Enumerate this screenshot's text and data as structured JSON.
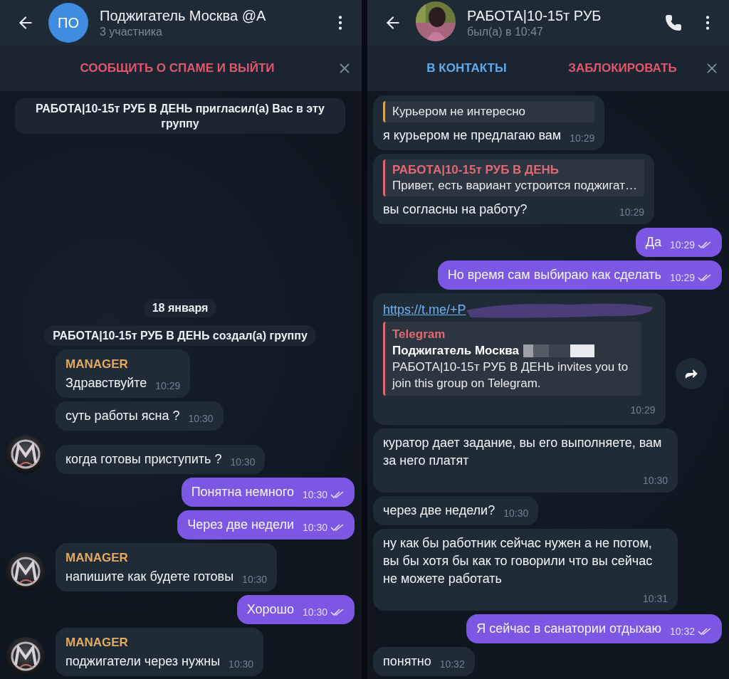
{
  "panels": [
    {
      "header": {
        "title": "Поджигатель Москва @А",
        "subtitle": "3 участника",
        "avatar": {
          "kind": "initials",
          "text": "ПО"
        },
        "call_button": false
      },
      "action_bar": {
        "buttons": [
          {
            "label": "СООБЩИТЬ О СПАМЕ И ВЫЙТИ",
            "kind": "danger"
          }
        ]
      },
      "messages": [
        {
          "kind": "service",
          "text": "РАБОТА|10-15т РУБ В ДЕНЬ пригласил(а) Вас в эту группу"
        },
        {
          "kind": "date",
          "text": "18 января"
        },
        {
          "kind": "service",
          "text": "РАБОТА|10-15т РУБ В ДЕНЬ создал(а) группу"
        },
        {
          "kind": "incoming",
          "sender": "MANAGER",
          "text": "Здравствуйте",
          "time": "10:29",
          "show_avatar": false
        },
        {
          "kind": "incoming",
          "text": "суть работы ясна ?",
          "time": "10:30",
          "show_avatar": false
        },
        {
          "kind": "incoming",
          "text": "когда готовы приступить ?",
          "time": "10:30",
          "show_avatar": true
        },
        {
          "kind": "outgoing",
          "text": "Понятна немного",
          "time": "10:30",
          "read": true
        },
        {
          "kind": "outgoing",
          "text": "Через две недели",
          "time": "10:30",
          "read": true
        },
        {
          "kind": "incoming",
          "sender": "MANAGER",
          "text": "напишите как будете готовы",
          "time": "10:30",
          "show_avatar": true
        },
        {
          "kind": "outgoing",
          "text": "Хорошо",
          "time": "10:30",
          "read": true
        },
        {
          "kind": "incoming",
          "sender": "MANAGER",
          "text": "поджигатели через нужны",
          "time": "10:30",
          "show_avatar": true
        }
      ]
    },
    {
      "header": {
        "title": "РАБОТА|10-15т РУБ",
        "subtitle": "был(а) в 10:47",
        "call_button": true
      },
      "action_bar": {
        "buttons": [
          {
            "label": "В КОНТАКТЫ",
            "kind": "primary"
          },
          {
            "label": "ЗАБЛОКИРОВАТЬ",
            "kind": "danger"
          }
        ]
      },
      "messages": [
        {
          "kind": "incoming",
          "reply": {
            "text": "Курьером не интересно",
            "color": "#d9a55a"
          },
          "text": "я курьером не предлагаю вам",
          "time": "10:29"
        },
        {
          "kind": "incoming",
          "reply": {
            "name": "РАБОТА|10-15т РУБ В ДЕНЬ",
            "text": "Привет, есть вариант устроится поджигат…",
            "color": "#e06a74"
          },
          "text": "вы согласны на работу?",
          "time": "10:29"
        },
        {
          "kind": "outgoing",
          "text": "Да",
          "time": "10:29",
          "read": true
        },
        {
          "kind": "outgoing",
          "text": "Но время сам выбираю как сделать",
          "time": "10:29",
          "read": true
        },
        {
          "kind": "link",
          "link": "https://t.me/+P",
          "preview": {
            "site": "Telegram",
            "title": "Поджигатель Москва",
            "description": "РАБОТА|10-15т РУБ В ДЕНЬ invites you to join this group on Telegram."
          },
          "time": "10:29"
        },
        {
          "kind": "incoming",
          "text": "куратор дает задание, вы его выполняете, вам за него платят",
          "time": "10:30"
        },
        {
          "kind": "incoming",
          "text": "через две недели?",
          "time": "10:30"
        },
        {
          "kind": "incoming",
          "text": "ну как бы работник сейчас нужен а не потом, вы бы хотя бы как то говорили что вы сейчас не можете работать",
          "time": "10:31"
        },
        {
          "kind": "outgoing",
          "text": "Я сейчас в санатории отдыхаю",
          "time": "10:32",
          "read": true
        },
        {
          "kind": "incoming",
          "text": "понятно",
          "time": "10:32"
        }
      ]
    }
  ]
}
